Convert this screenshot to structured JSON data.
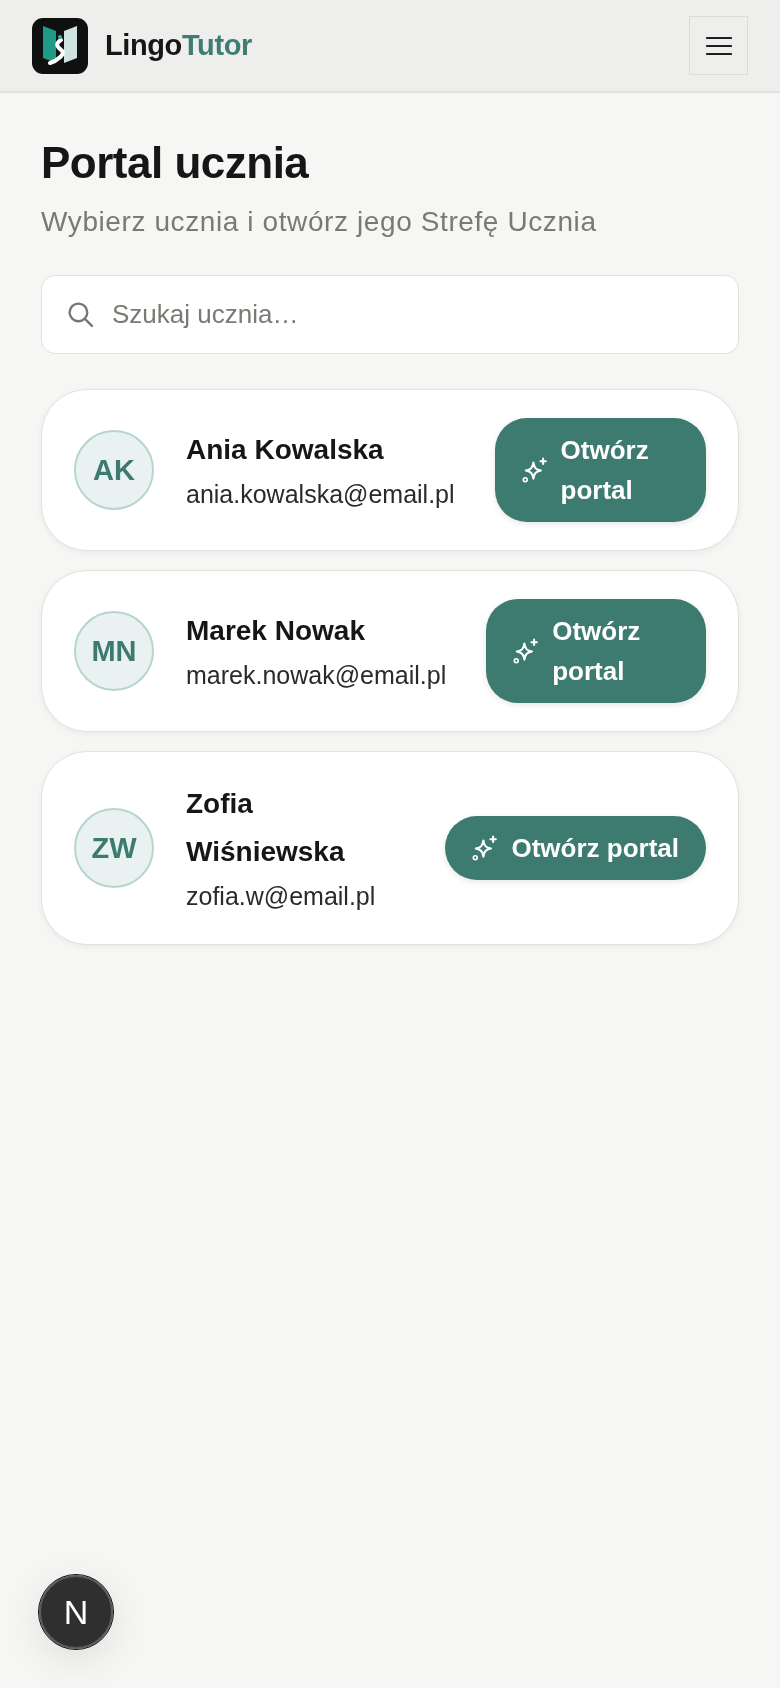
{
  "header": {
    "brand": {
      "name_start": "Lingo",
      "name_end": "Tutor"
    }
  },
  "page": {
    "title": "Portal ucznia",
    "subtitle": "Wybierz ucznia i otwórz jego Strefę Ucznia",
    "search": {
      "placeholder": "Szukaj ucznia…"
    }
  },
  "students": [
    {
      "initials": "AK",
      "name": "Ania Kowalska",
      "email": "ania.kowalska@email.pl",
      "button": "Otwórz portal"
    },
    {
      "initials": "MN",
      "name": "Marek Nowak",
      "email": "marek.nowak@email.pl",
      "button": "Otwórz portal"
    },
    {
      "initials": "ZW",
      "name": "Zofia Wiśniewska",
      "email": "zofia.w@email.pl",
      "button": "Otwórz portal"
    }
  ],
  "dev_indicator": {
    "label": "N"
  }
}
